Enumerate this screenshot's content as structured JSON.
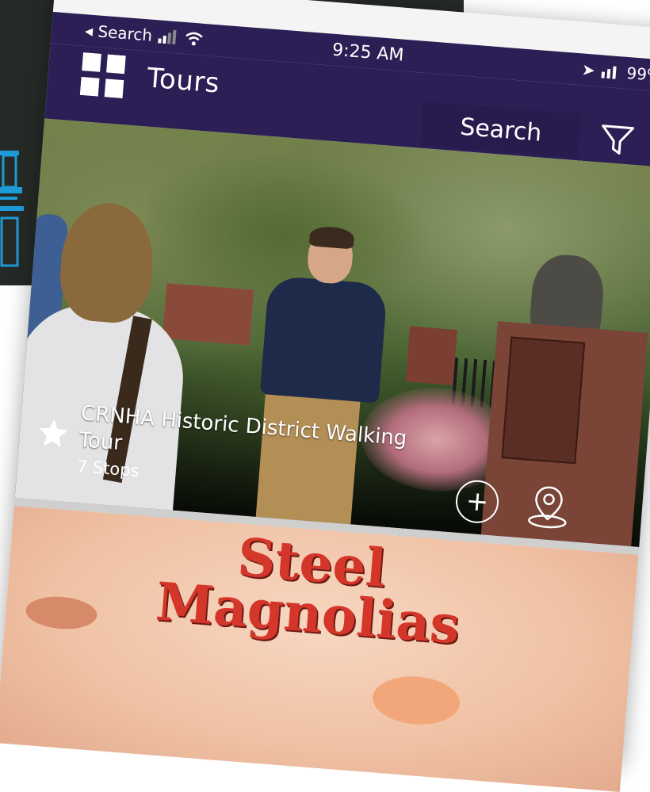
{
  "status_bar": {
    "back_label": "◂ Search",
    "time": "9:25 AM",
    "battery": "99%"
  },
  "app_bar": {
    "title": "Tours",
    "search_label": "Search"
  },
  "tours": [
    {
      "title": "CRNHA Historic District Walking Tour",
      "stops": "7 Stops",
      "favorited": true
    }
  ],
  "poster": {
    "title_line1": "Steel",
    "title_line2": "Magnolias"
  },
  "colors": {
    "app_bar": "#2b1f55",
    "backdrop": "#252a27",
    "poster_title": "#d5362a"
  }
}
